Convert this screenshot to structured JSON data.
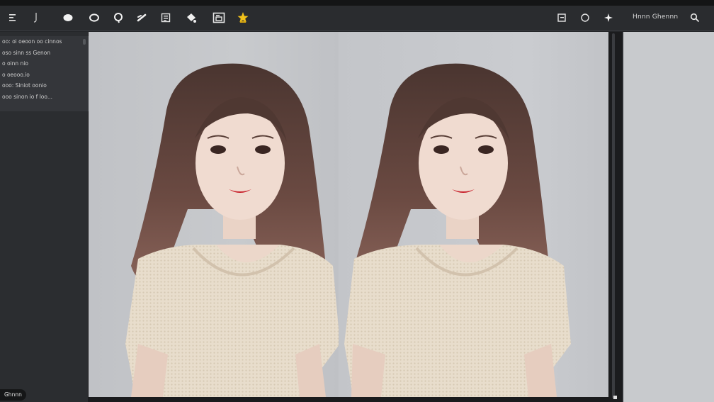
{
  "toolbar": {
    "status_text": "Hnnn Ghennn"
  },
  "layers": [
    "oo: oi oeoon oo cinnos",
    "oso sinn ss Genon",
    "o oinn nio",
    "o oeooo.io",
    "ooo: Siniot oonio",
    "ooo sinon io f loo..."
  ],
  "status": {
    "badge": "Ghnnn"
  },
  "colors": {
    "toolbar_bg": "#2a2c2f",
    "panel_bg": "#2b2d30",
    "canvas_bg": "#c4c6ca",
    "accent_star": "#f2c21a"
  }
}
